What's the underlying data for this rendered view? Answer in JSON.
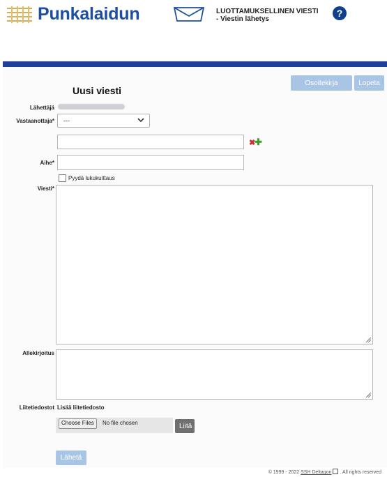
{
  "header": {
    "logo_text": "Punkalaidun",
    "title_line1": "LUOTTAMUKSELLINEN VIESTI",
    "title_line2": "- Viestin lähetys",
    "help_symbol": "?"
  },
  "toolbar": {
    "address_book_label": "Osoitekirja",
    "quit_label": "Lopeta"
  },
  "form": {
    "title": "Uusi viesti",
    "sender_label": "Lähettäjä",
    "recipient_label": "Vastaanottaja*",
    "recipient_selected": "---",
    "recipient_input_value": "",
    "subject_label": "Aihe*",
    "subject_value": "",
    "read_receipt_label": "Pyydä lukukuittaus",
    "read_receipt_checked": false,
    "message_label": "Viesti*",
    "message_value": "",
    "signature_label": "Allekirjoitus",
    "signature_value": "",
    "attachments_label": "Liitetiedostot",
    "add_attachment_label": "Lisää liitetiedosto",
    "choose_files_label": "Choose Files",
    "no_file_text": "No file chosen",
    "attach_label": "Liitä",
    "send_label": "Lähetä"
  },
  "footer": {
    "copyright": "© 1999 - 2022",
    "company_link": "SSH Deltagon",
    "rights": ". All rights reserved"
  },
  "colors": {
    "brand_blue": "#1c4ea2",
    "top_bar": "#1e3f9a",
    "light_button": "#a9c5e6",
    "attach_button": "#6f6f6f"
  },
  "icons": {
    "logo": "fence-logo-icon",
    "envelope": "envelope-icon",
    "help": "help-icon",
    "remove": "remove-recipient-icon",
    "add": "add-recipient-icon",
    "dropdown": "chevron-down-icon",
    "external": "external-link-icon"
  }
}
